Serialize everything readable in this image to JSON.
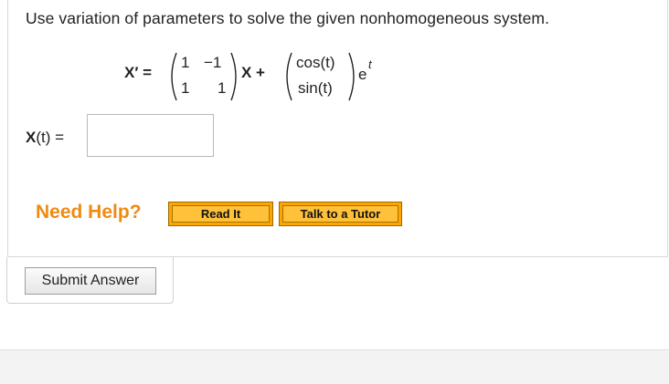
{
  "question": {
    "text": "Use variation of parameters to solve the given nonhomogeneous system."
  },
  "equation": {
    "lhs": "X′ =",
    "matrix": [
      "1",
      "−1",
      "1",
      "1"
    ],
    "vector_var": "X +",
    "forcing": [
      "cos(t)",
      "sin(t)"
    ],
    "exp_base": "e",
    "exp_power": "t"
  },
  "answer": {
    "label_var": "X",
    "label_rest": "(t) =",
    "value": ""
  },
  "help": {
    "title": "Need Help?",
    "read_it": "Read It",
    "talk_tutor": "Talk to a Tutor"
  },
  "submit": {
    "label": "Submit Answer"
  }
}
